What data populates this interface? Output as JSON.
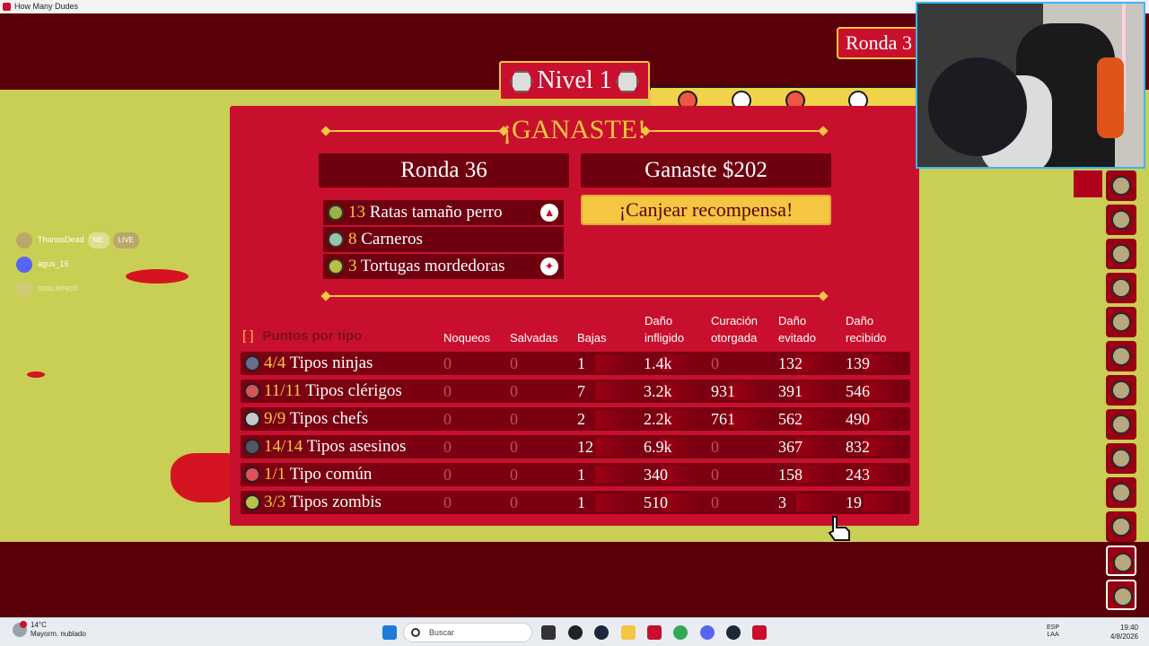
{
  "window": {
    "title": "How Many Dudes"
  },
  "hud": {
    "ronda_badge": "Ronda 3",
    "nivel": "Nivel 1"
  },
  "results": {
    "heading": "¡GANASTE!",
    "ronda": "Ronda 36",
    "ganaste": "Ganaste $202",
    "canjear": "¡Canjear recompensa!",
    "enemies": [
      {
        "count": "13",
        "name": "Ratas tamaño perro",
        "icon": "rat-icon",
        "flag": "wolf-head-icon"
      },
      {
        "count": "8",
        "name": "Carneros",
        "icon": "ram-icon",
        "flag": ""
      },
      {
        "count": "3",
        "name": "Tortugas mordedoras",
        "icon": "turtle-icon",
        "flag": "claw-icon"
      }
    ]
  },
  "stats": {
    "points_label": "Puntos por tipo",
    "headers": {
      "noqueos": "Noqueos",
      "salvadas": "Salvadas",
      "bajas": "Bajas",
      "dano_infligido_1": "Daño",
      "dano_infligido_2": "infligido",
      "curacion_1": "Curación",
      "curacion_2": "otorgada",
      "dano_evitado_1": "Daño",
      "dano_evitado_2": "evitado",
      "dano_recibido_1": "Daño",
      "dano_recibido_2": "recibido"
    },
    "rows": [
      {
        "count": "4/4",
        "name": "Tipos ninjas",
        "noqueos": "0",
        "salvadas": "0",
        "bajas": "1",
        "infligido": "1.4k",
        "curacion": "0",
        "evitado": "132",
        "recibido": "139",
        "icon": "ninja-icon",
        "icon_color": "#6b6b8a"
      },
      {
        "count": "11/11",
        "name": "Tipos clérigos",
        "noqueos": "0",
        "salvadas": "0",
        "bajas": "7",
        "infligido": "3.2k",
        "curacion": "931",
        "evitado": "391",
        "recibido": "546",
        "icon": "cleric-icon",
        "icon_color": "#d4555a"
      },
      {
        "count": "9/9",
        "name": "Tipos chefs",
        "noqueos": "0",
        "salvadas": "0",
        "bajas": "2",
        "infligido": "2.2k",
        "curacion": "761",
        "evitado": "562",
        "recibido": "490",
        "icon": "chef-icon",
        "icon_color": "#c8c8c8"
      },
      {
        "count": "14/14",
        "name": "Tipos asesinos",
        "noqueos": "0",
        "salvadas": "0",
        "bajas": "12",
        "infligido": "6.9k",
        "curacion": "0",
        "evitado": "367",
        "recibido": "832",
        "icon": "assassin-icon",
        "icon_color": "#555566"
      },
      {
        "count": "1/1",
        "name": "Tipo común",
        "noqueos": "0",
        "salvadas": "0",
        "bajas": "1",
        "infligido": "340",
        "curacion": "0",
        "evitado": "158",
        "recibido": "243",
        "icon": "common-dude-icon",
        "icon_color": "#e0505a"
      },
      {
        "count": "3/3",
        "name": "Tipos zombis",
        "noqueos": "0",
        "salvadas": "0",
        "bajas": "1",
        "infligido": "510",
        "curacion": "0",
        "evitado": "3",
        "recibido": "19",
        "icon": "zombie-icon",
        "icon_color": "#b8c24a"
      }
    ]
  },
  "chat": {
    "user1": "ThanosDead",
    "user1_tag": "ME",
    "user1_badge": "LIVE",
    "user2": "agus_16",
    "user3": "mou.lerech"
  },
  "taskbar": {
    "temp": "14°C",
    "weather": "Mayorm. nublado",
    "search_placeholder": "Buscar",
    "lang1": "ESP",
    "lang2": "LAA",
    "time": "19:40",
    "date": "4/8/2026"
  },
  "colors": {
    "panel": "#c8102e",
    "dark": "#5a0008",
    "gold": "#f4c642",
    "field": "#c9cf54"
  }
}
